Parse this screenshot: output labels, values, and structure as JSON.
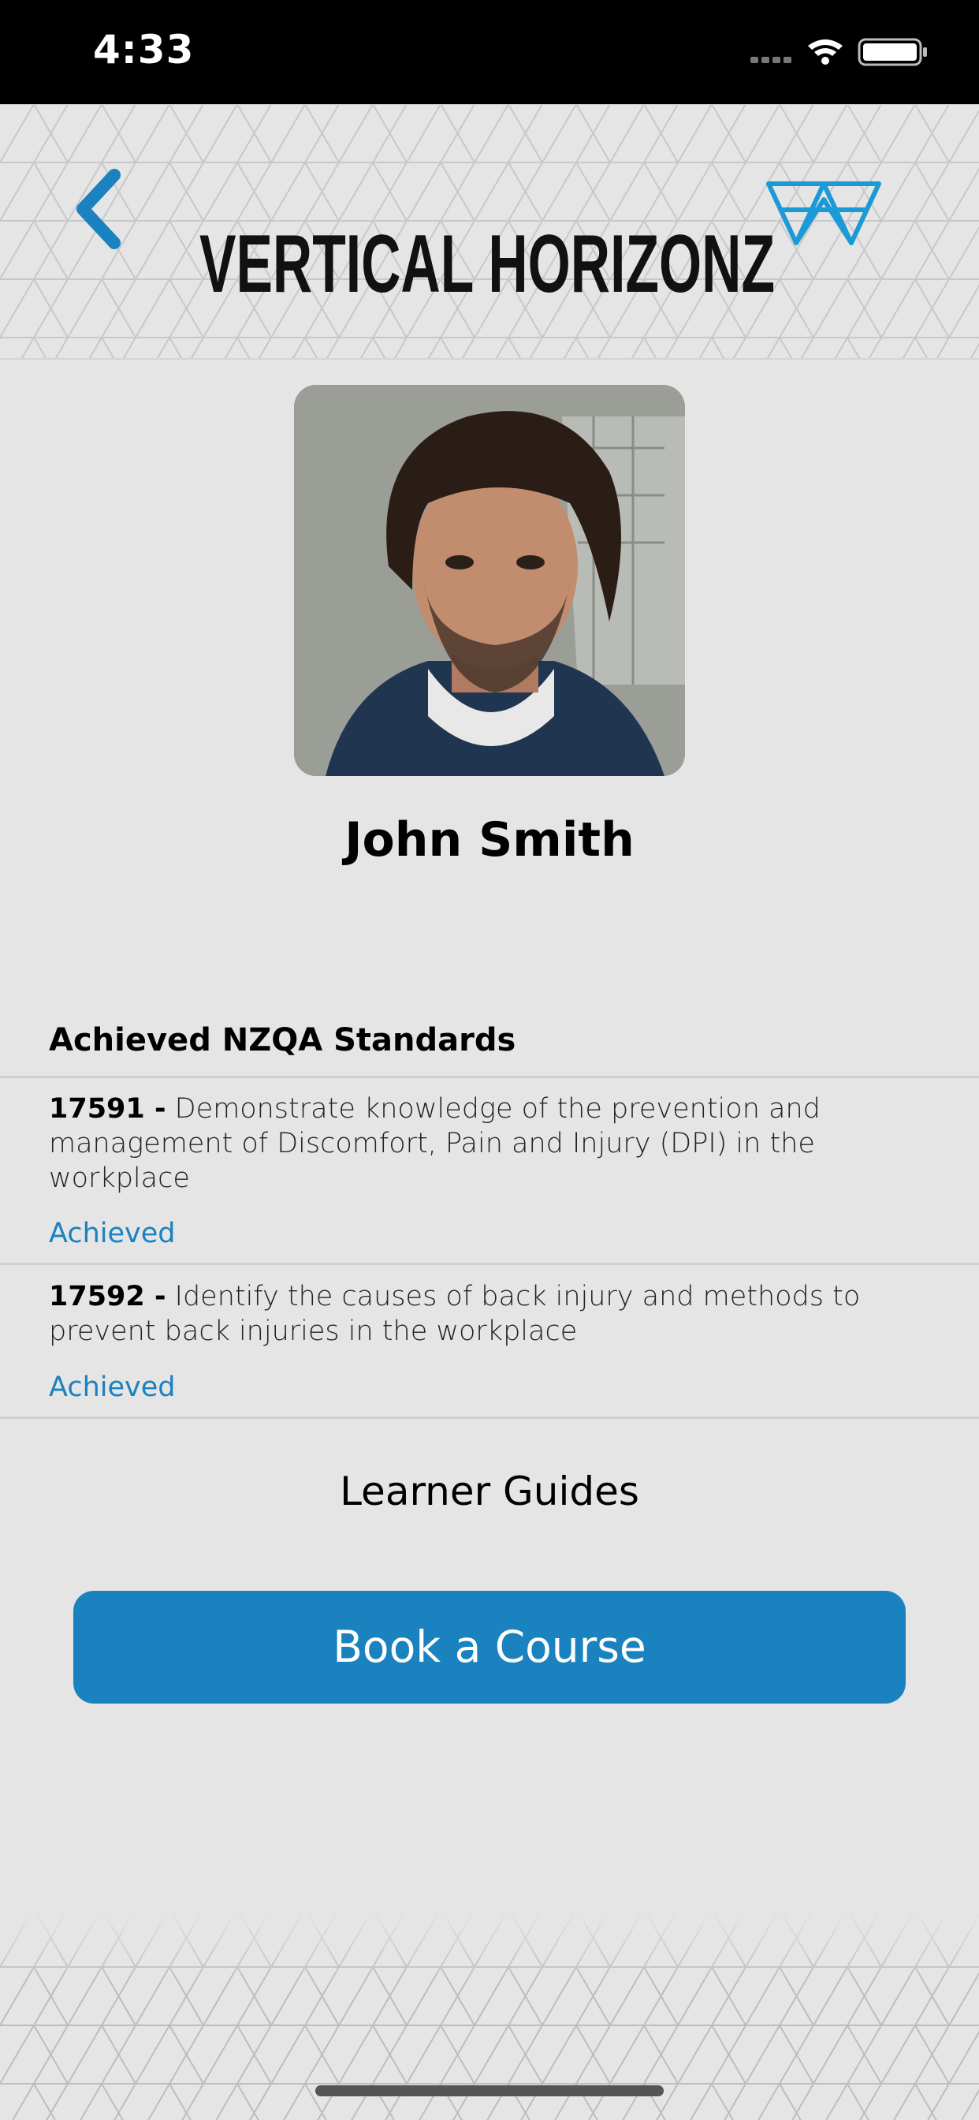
{
  "status_bar": {
    "time": "4:33"
  },
  "header": {
    "brand": "VERTICAL HORIZONZ"
  },
  "profile": {
    "name": "John Smith"
  },
  "standards": {
    "title": "Achieved NZQA Standards",
    "items": [
      {
        "code": "17591 -",
        "description": "Demonstrate knowledge of the prevention and management of Discomfort, Pain and Injury (DPI) in the workplace",
        "status": "Achieved"
      },
      {
        "code": "17592 -",
        "description": "Identify the causes of back injury and methods to prevent back injuries in the workplace",
        "status": "Achieved"
      }
    ]
  },
  "learner_guides": {
    "label": "Learner Guides"
  },
  "book_button": {
    "label": "Book a Course"
  },
  "colors": {
    "accent": "#1a82bf",
    "background": "#e5e5e5"
  },
  "icons": [
    "back-chevron-icon",
    "brand-mark-icon",
    "signal-icon",
    "wifi-icon",
    "battery-icon"
  ]
}
